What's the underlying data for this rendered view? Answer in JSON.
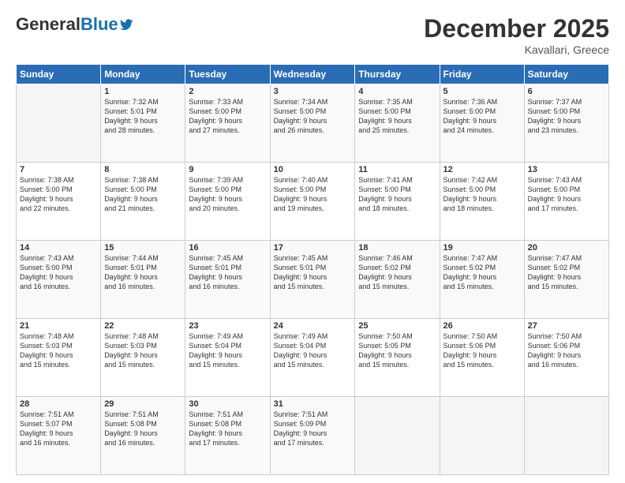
{
  "header": {
    "logo_general": "General",
    "logo_blue": "Blue",
    "month_title": "December 2025",
    "location": "Kavallari, Greece"
  },
  "columns": [
    "Sunday",
    "Monday",
    "Tuesday",
    "Wednesday",
    "Thursday",
    "Friday",
    "Saturday"
  ],
  "weeks": [
    [
      {
        "day": "",
        "info": ""
      },
      {
        "day": "1",
        "info": "Sunrise: 7:32 AM\nSunset: 5:01 PM\nDaylight: 9 hours\nand 28 minutes."
      },
      {
        "day": "2",
        "info": "Sunrise: 7:33 AM\nSunset: 5:00 PM\nDaylight: 9 hours\nand 27 minutes."
      },
      {
        "day": "3",
        "info": "Sunrise: 7:34 AM\nSunset: 5:00 PM\nDaylight: 9 hours\nand 26 minutes."
      },
      {
        "day": "4",
        "info": "Sunrise: 7:35 AM\nSunset: 5:00 PM\nDaylight: 9 hours\nand 25 minutes."
      },
      {
        "day": "5",
        "info": "Sunrise: 7:36 AM\nSunset: 5:00 PM\nDaylight: 9 hours\nand 24 minutes."
      },
      {
        "day": "6",
        "info": "Sunrise: 7:37 AM\nSunset: 5:00 PM\nDaylight: 9 hours\nand 23 minutes."
      }
    ],
    [
      {
        "day": "7",
        "info": "Sunrise: 7:38 AM\nSunset: 5:00 PM\nDaylight: 9 hours\nand 22 minutes."
      },
      {
        "day": "8",
        "info": "Sunrise: 7:38 AM\nSunset: 5:00 PM\nDaylight: 9 hours\nand 21 minutes."
      },
      {
        "day": "9",
        "info": "Sunrise: 7:39 AM\nSunset: 5:00 PM\nDaylight: 9 hours\nand 20 minutes."
      },
      {
        "day": "10",
        "info": "Sunrise: 7:40 AM\nSunset: 5:00 PM\nDaylight: 9 hours\nand 19 minutes."
      },
      {
        "day": "11",
        "info": "Sunrise: 7:41 AM\nSunset: 5:00 PM\nDaylight: 9 hours\nand 18 minutes."
      },
      {
        "day": "12",
        "info": "Sunrise: 7:42 AM\nSunset: 5:00 PM\nDaylight: 9 hours\nand 18 minutes."
      },
      {
        "day": "13",
        "info": "Sunrise: 7:43 AM\nSunset: 5:00 PM\nDaylight: 9 hours\nand 17 minutes."
      }
    ],
    [
      {
        "day": "14",
        "info": "Sunrise: 7:43 AM\nSunset: 5:00 PM\nDaylight: 9 hours\nand 16 minutes."
      },
      {
        "day": "15",
        "info": "Sunrise: 7:44 AM\nSunset: 5:01 PM\nDaylight: 9 hours\nand 16 minutes."
      },
      {
        "day": "16",
        "info": "Sunrise: 7:45 AM\nSunset: 5:01 PM\nDaylight: 9 hours\nand 16 minutes."
      },
      {
        "day": "17",
        "info": "Sunrise: 7:45 AM\nSunset: 5:01 PM\nDaylight: 9 hours\nand 15 minutes."
      },
      {
        "day": "18",
        "info": "Sunrise: 7:46 AM\nSunset: 5:02 PM\nDaylight: 9 hours\nand 15 minutes."
      },
      {
        "day": "19",
        "info": "Sunrise: 7:47 AM\nSunset: 5:02 PM\nDaylight: 9 hours\nand 15 minutes."
      },
      {
        "day": "20",
        "info": "Sunrise: 7:47 AM\nSunset: 5:02 PM\nDaylight: 9 hours\nand 15 minutes."
      }
    ],
    [
      {
        "day": "21",
        "info": "Sunrise: 7:48 AM\nSunset: 5:03 PM\nDaylight: 9 hours\nand 15 minutes."
      },
      {
        "day": "22",
        "info": "Sunrise: 7:48 AM\nSunset: 5:03 PM\nDaylight: 9 hours\nand 15 minutes."
      },
      {
        "day": "23",
        "info": "Sunrise: 7:49 AM\nSunset: 5:04 PM\nDaylight: 9 hours\nand 15 minutes."
      },
      {
        "day": "24",
        "info": "Sunrise: 7:49 AM\nSunset: 5:04 PM\nDaylight: 9 hours\nand 15 minutes."
      },
      {
        "day": "25",
        "info": "Sunrise: 7:50 AM\nSunset: 5:05 PM\nDaylight: 9 hours\nand 15 minutes."
      },
      {
        "day": "26",
        "info": "Sunrise: 7:50 AM\nSunset: 5:06 PM\nDaylight: 9 hours\nand 15 minutes."
      },
      {
        "day": "27",
        "info": "Sunrise: 7:50 AM\nSunset: 5:06 PM\nDaylight: 9 hours\nand 16 minutes."
      }
    ],
    [
      {
        "day": "28",
        "info": "Sunrise: 7:51 AM\nSunset: 5:07 PM\nDaylight: 9 hours\nand 16 minutes."
      },
      {
        "day": "29",
        "info": "Sunrise: 7:51 AM\nSunset: 5:08 PM\nDaylight: 9 hours\nand 16 minutes."
      },
      {
        "day": "30",
        "info": "Sunrise: 7:51 AM\nSunset: 5:08 PM\nDaylight: 9 hours\nand 17 minutes."
      },
      {
        "day": "31",
        "info": "Sunrise: 7:51 AM\nSunset: 5:09 PM\nDaylight: 9 hours\nand 17 minutes."
      },
      {
        "day": "",
        "info": ""
      },
      {
        "day": "",
        "info": ""
      },
      {
        "day": "",
        "info": ""
      }
    ]
  ]
}
